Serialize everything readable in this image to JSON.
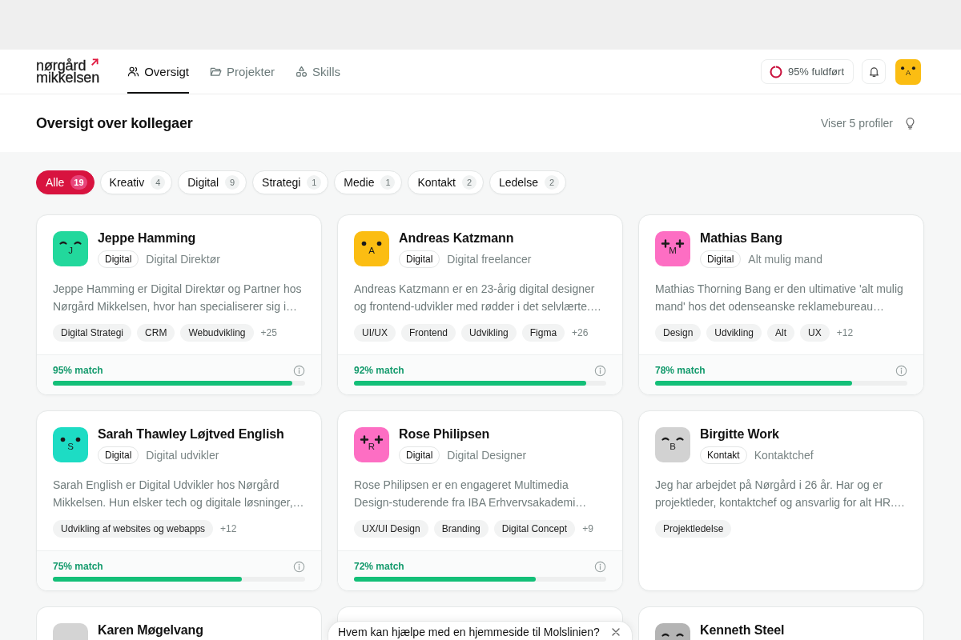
{
  "header": {
    "logo": {
      "lines": [
        "nørgård",
        "mikkelsen"
      ]
    },
    "nav": [
      {
        "label": "Oversigt",
        "selected": true
      },
      {
        "label": "Projekter",
        "selected": false
      },
      {
        "label": "Skills",
        "selected": false
      }
    ],
    "completion": {
      "label": "95% fuldført",
      "level": 0.95
    },
    "user_avatar": {
      "initial": "A",
      "kind": "dots"
    }
  },
  "page": {
    "title": "Oversigt over kollegaer",
    "summary": "Viser 5 profiler"
  },
  "filters": [
    {
      "label": "Alle",
      "count": "19",
      "selected": true
    },
    {
      "label": "Kreativ",
      "count": "4",
      "selected": false
    },
    {
      "label": "Digital",
      "count": "9",
      "selected": false
    },
    {
      "label": "Strategi",
      "count": "1",
      "selected": false
    },
    {
      "label": "Medie",
      "count": "1",
      "selected": false
    },
    {
      "label": "Kontakt",
      "count": "2",
      "selected": false
    },
    {
      "label": "Ledelse",
      "count": "2",
      "selected": false
    }
  ],
  "profiles": [
    {
      "name": "Jeppe Hamming",
      "avatar": {
        "initial": "J",
        "kind": "closed",
        "color": "#22d89c"
      },
      "department": "Digital",
      "role": "Digital Direktør",
      "bio": "Jeppe Hamming er Digital Direktør og Partner hos Nørgård Mikkelsen, hvor han specialiserer sig i…",
      "tags": [
        "Digital Strategi",
        "CRM",
        "Webudvikling"
      ],
      "more": "+25",
      "match": {
        "label": "95% match",
        "level": 0.95
      }
    },
    {
      "name": "Andreas Katzmann",
      "avatar": {
        "initial": "A",
        "kind": "dots",
        "color": "#fbbd12"
      },
      "department": "Digital",
      "role": "Digital freelancer",
      "bio": "Andreas Katzmann er en 23-årig digital designer og frontend-udvikler med rødder i det selvlærte.…",
      "tags": [
        "UI/UX",
        "Frontend",
        "Udvikling",
        "Figma"
      ],
      "more": "+26",
      "match": {
        "label": "92% match",
        "level": 0.92
      }
    },
    {
      "name": "Mathias Bang",
      "avatar": {
        "initial": "M",
        "kind": "plus",
        "color": "#fd6ec3"
      },
      "department": "Digital",
      "role": "Alt mulig mand",
      "bio": "Mathias Thorning Bang er den ultimative 'alt mulig mand' hos det odenseanske reklamebureau…",
      "tags": [
        "Design",
        "Udvikling",
        "Alt",
        "UX"
      ],
      "more": "+12",
      "match": {
        "label": "78% match",
        "level": 0.78
      }
    },
    {
      "name": "Sarah Thawley Løjtved English",
      "avatar": {
        "initial": "S",
        "kind": "dots",
        "color": "#1ddcc4"
      },
      "department": "Digital",
      "role": "Digital udvikler",
      "bio": "Sarah English er Digital Udvikler hos Nørgård Mikkelsen. Hun elsker tech og digitale løsninger,…",
      "tags": [
        "Udvikling af websites og webapps"
      ],
      "more": "+12",
      "match": {
        "label": "75% match",
        "level": 0.75
      }
    },
    {
      "name": "Rose Philipsen",
      "avatar": {
        "initial": "R",
        "kind": "plus",
        "color": "#fd6ec3"
      },
      "department": "Digital",
      "role": "Digital Designer",
      "bio": "Rose Philipsen er en engageret Multimedia Design-studerende fra IBA Erhvervsakademi…",
      "tags": [
        "UX/UI Design",
        "Branding",
        "Digital Concept"
      ],
      "more": "+9",
      "match": {
        "label": "72% match",
        "level": 0.72
      }
    },
    {
      "name": "Birgitte Work",
      "avatar": {
        "initial": "B",
        "kind": "closed",
        "color": "#d2d2d2"
      },
      "department": "Kontakt",
      "role": "Kontaktchef",
      "bio": "Jeg har arbejdet på Nørgård i 26 år. Har og er projektleder, kontaktchef og ansvarlig for alt HR.…",
      "tags": [
        "Projektledelse"
      ]
    },
    {
      "name": "Karen Møgelvang",
      "avatar": {
        "color": "#d4d4d4"
      }
    },
    {
      "name": "Kenneth Steel",
      "avatar": {
        "kind": "closed",
        "color": "#b4b4b4"
      }
    }
  ],
  "suggestion": {
    "text": "Hvem kan hjælpe med en hjemmeside til Molslinien?"
  }
}
